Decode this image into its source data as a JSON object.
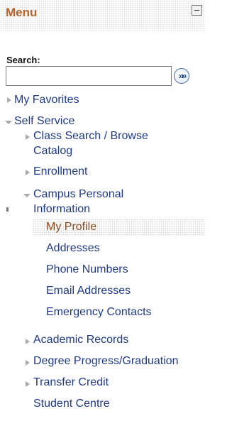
{
  "menu": {
    "title": "Menu",
    "search_label": "Search:",
    "search_value": "",
    "search_button_glyph": "»»",
    "items": [
      {
        "label": "My Favorites"
      },
      {
        "label": "Self Service"
      },
      {
        "label_line1": "Class Search / Browse",
        "label_line2": "Catalog"
      },
      {
        "label": "Enrollment"
      },
      {
        "label_line1": "Campus Personal",
        "label_line2": "Information"
      },
      {
        "label": "My Profile",
        "selected": true
      },
      {
        "label": "Addresses"
      },
      {
        "label": "Phone Numbers"
      },
      {
        "label": "Email Addresses"
      },
      {
        "label": "Emergency Contacts"
      },
      {
        "label": "Academic Records"
      },
      {
        "label": "Degree Progress/Graduation"
      },
      {
        "label": "Transfer Credit"
      },
      {
        "label": "Student Centre"
      }
    ]
  },
  "colors": {
    "title": "#b9632a",
    "link": "#1f3a8a",
    "selected": "#8a4b1e",
    "arrow": "#a9a9a9"
  },
  "icons": {
    "collapse": "collapse-minus-icon",
    "search": "double-chevron-right-icon",
    "collapsed": "triangle-right-icon",
    "expanded": "triangle-down-icon"
  }
}
